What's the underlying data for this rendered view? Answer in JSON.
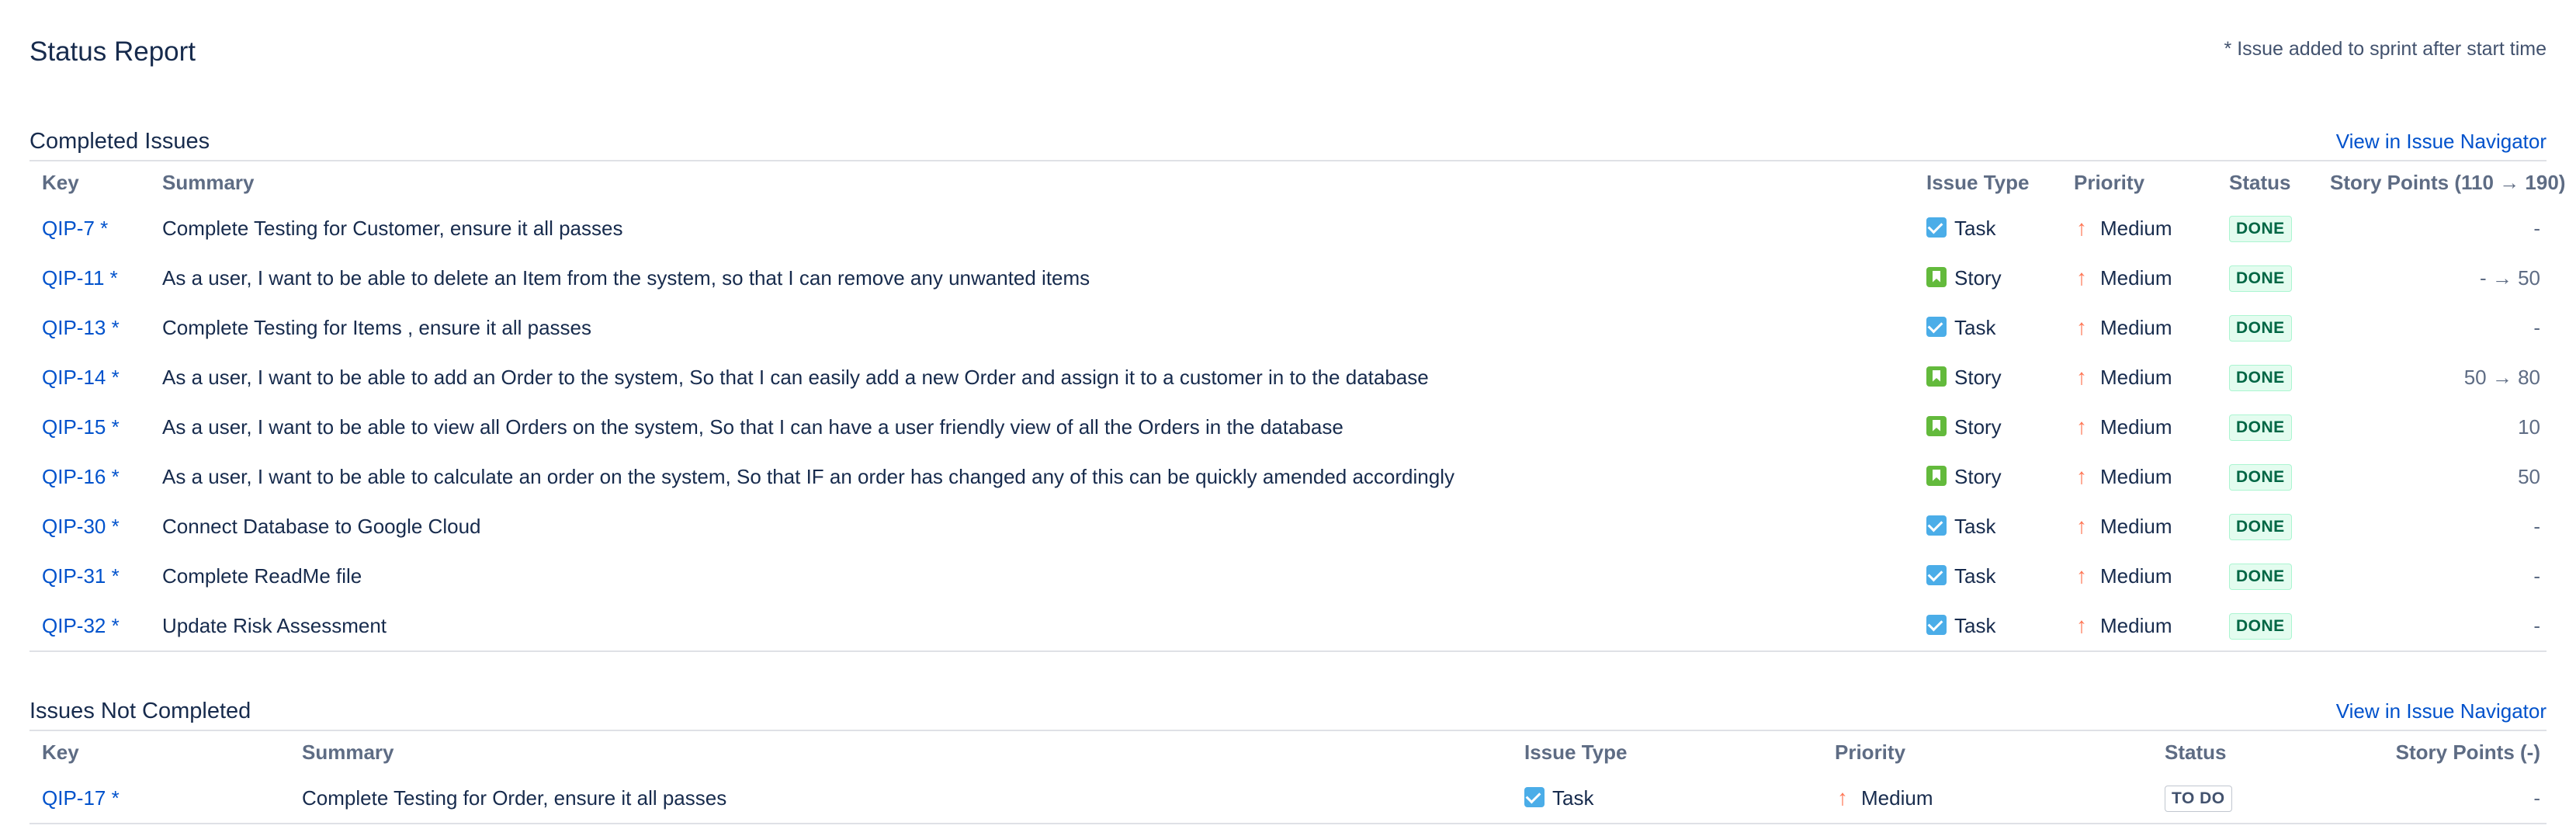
{
  "header": {
    "title": "Status Report",
    "note": "* Issue added to sprint after start time"
  },
  "completed": {
    "title": "Completed Issues",
    "navigator_link": "View in Issue Navigator",
    "columns": {
      "key": "Key",
      "summary": "Summary",
      "type": "Issue Type",
      "priority": "Priority",
      "status": "Status",
      "points": "Story Points (110 → 190)"
    },
    "rows": [
      {
        "key": "QIP-7 *",
        "summary": "Complete Testing for Customer, ensure it all passes",
        "type_icon": "task-icon",
        "type": "Task",
        "priority": "Medium",
        "status": "DONE",
        "points": "-"
      },
      {
        "key": "QIP-11 *",
        "summary": "As a user, I want to be able to delete an Item from the system, so that I can remove any unwanted items",
        "type_icon": "story-icon",
        "type": "Story",
        "priority": "Medium",
        "status": "DONE",
        "points": "- → 50"
      },
      {
        "key": "QIP-13 *",
        "summary": "Complete Testing for Items , ensure it all passes",
        "type_icon": "task-icon",
        "type": "Task",
        "priority": "Medium",
        "status": "DONE",
        "points": "-"
      },
      {
        "key": "QIP-14 *",
        "summary": "As a user, I want to be able to add an Order to the system, So that I can easily add a new Order and assign it to a customer in to the database",
        "type_icon": "story-icon",
        "type": "Story",
        "priority": "Medium",
        "status": "DONE",
        "points": "50 → 80"
      },
      {
        "key": "QIP-15 *",
        "summary": "As a user, I want to be able to view all Orders on the system, So that I can have a user friendly view of all the Orders in the database",
        "type_icon": "story-icon",
        "type": "Story",
        "priority": "Medium",
        "status": "DONE",
        "points": "10"
      },
      {
        "key": "QIP-16 *",
        "summary": "As a user, I want to be able to calculate an order on the system, So that IF an order has changed any of this can be quickly amended accordingly",
        "type_icon": "story-icon",
        "type": "Story",
        "priority": "Medium",
        "status": "DONE",
        "points": "50"
      },
      {
        "key": "QIP-30 *",
        "summary": "Connect Database to Google Cloud",
        "type_icon": "task-icon",
        "type": "Task",
        "priority": "Medium",
        "status": "DONE",
        "points": "-"
      },
      {
        "key": "QIP-31 *",
        "summary": "Complete ReadMe file",
        "type_icon": "task-icon",
        "type": "Task",
        "priority": "Medium",
        "status": "DONE",
        "points": "-"
      },
      {
        "key": "QIP-32 *",
        "summary": "Update Risk Assessment",
        "type_icon": "task-icon",
        "type": "Task",
        "priority": "Medium",
        "status": "DONE",
        "points": "-"
      }
    ]
  },
  "not_completed": {
    "title": "Issues Not Completed",
    "navigator_link": "View in Issue Navigator",
    "columns": {
      "key": "Key",
      "summary": "Summary",
      "type": "Issue Type",
      "priority": "Priority",
      "status": "Status",
      "points": "Story Points (-)"
    },
    "rows": [
      {
        "key": "QIP-17 *",
        "summary": "Complete Testing for Order, ensure it all passes",
        "type_icon": "task-icon",
        "type": "Task",
        "priority": "Medium",
        "status": "TO DO",
        "points": "-"
      }
    ]
  },
  "colors": {
    "link": "#0052cc",
    "done_text": "#006644",
    "done_bg": "#e3fcef",
    "priority_medium": "#ff7452",
    "task": "#4bade8",
    "story": "#63ba3c"
  },
  "icons": {
    "priority_medium": "arrow-up-icon"
  }
}
